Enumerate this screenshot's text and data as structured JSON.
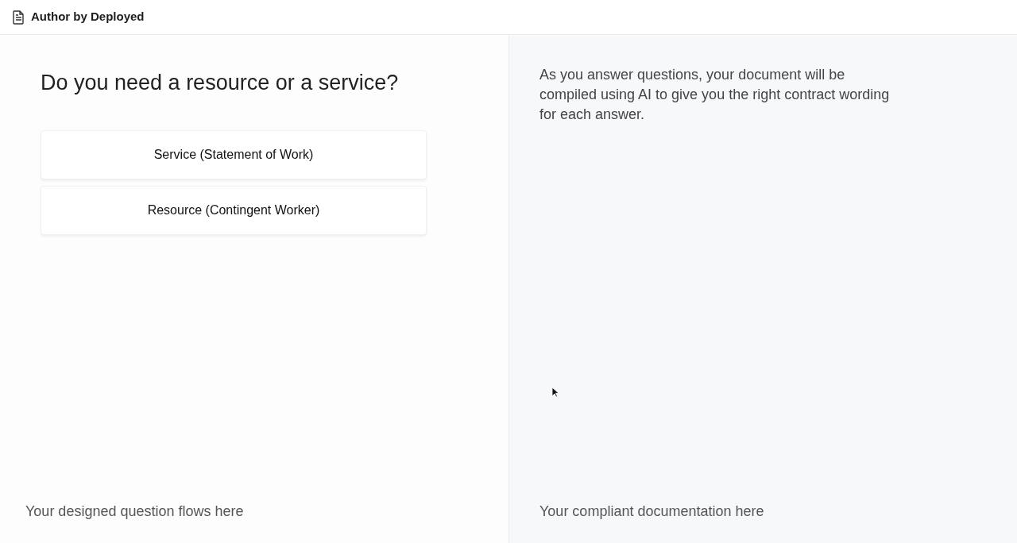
{
  "header": {
    "title": "Author by Deployed"
  },
  "question_panel": {
    "question": "Do you need a resource or a service?",
    "options": [
      {
        "label": "Service (Statement of Work)"
      },
      {
        "label": "Resource (Contingent Worker)"
      }
    ],
    "footer": "Your designed question flows here"
  },
  "document_panel": {
    "intro": "As you answer questions, your document will be compiled using AI to give you the right contract wording for each answer.",
    "footer": "Your compliant documentation here"
  }
}
